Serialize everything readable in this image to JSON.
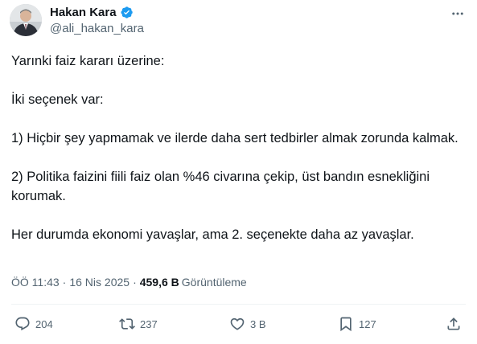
{
  "author": {
    "display_name": "Hakan Kara",
    "handle": "@ali_hakan_kara",
    "verified": true,
    "verified_color": "#1d9bf0"
  },
  "tweet": {
    "lines": [
      "Yarınki faiz kararı üzerine:",
      "",
      "İki seçenek var:",
      "",
      "1) Hiçbir şey yapmamak ve ilerde daha sert tedbirler almak zorunda kalmak.",
      "",
      "2) Politika faizini fiili faiz olan %46 civarına çekip, üst bandın esnekliğini korumak.",
      "",
      "Her durumda ekonomi yavaşlar, ama 2. seçenekte daha az yavaşlar."
    ]
  },
  "meta": {
    "time": "ÖÖ 11:43",
    "separator": "·",
    "date": "16 Nis 2025",
    "views_count": "459,6 B",
    "views_label": "Görüntüleme"
  },
  "actions": {
    "replies": "204",
    "reposts": "237",
    "likes": "3 B",
    "bookmarks": "127"
  },
  "icons": {
    "more": "more-icon",
    "reply": "reply-icon",
    "repost": "repost-icon",
    "like": "heart-icon",
    "bookmark": "bookmark-icon",
    "share": "share-icon"
  }
}
